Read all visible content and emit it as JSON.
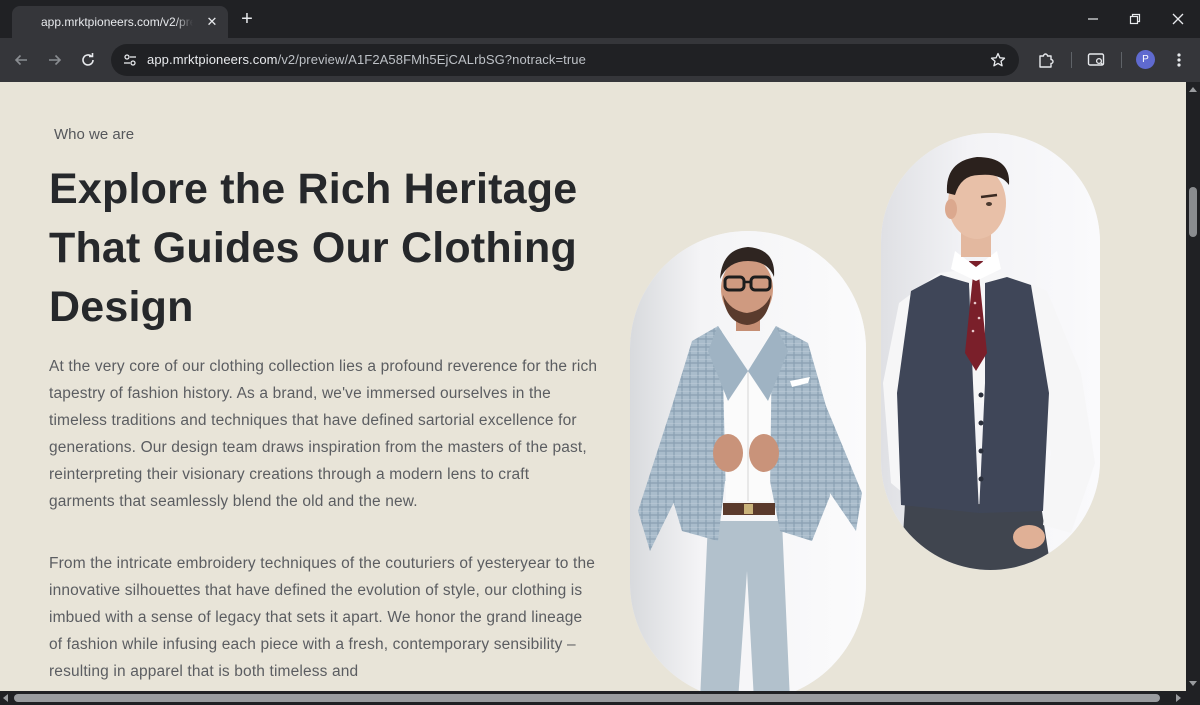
{
  "browser": {
    "tab_title": "app.mrktpioneers.com/v2/preview/A1F2A58FMh5EjCALrbSG",
    "url_host": "app.mrktpioneers.com",
    "url_path": "/v2/preview/A1F2A58FMh5EjCALrbSG?notrack=true",
    "profile_initial": "P",
    "close_tab_glyph": "✕",
    "new_tab_glyph": "+"
  },
  "page": {
    "eyebrow": "Who we are",
    "headline": "Explore the Rich Heritage That Guides Our Clothing Design",
    "paragraph_1": "At the very core of our clothing collection lies a profound reverence for the rich tapestry of fashion history. As a brand, we've immersed ourselves in the timeless traditions and techniques that have defined sartorial excellence for generations. Our design team draws inspiration from the masters of the past, reinterpreting their visionary creations through a modern lens to craft garments that seamlessly blend the old and the new.",
    "paragraph_2": "From the intricate embroidery techniques of the couturiers of yesteryear to the innovative silhouettes that have defined the evolution of style, our clothing is imbued with a sense of legacy that sets it apart. We honor the grand lineage of fashion while infusing each piece with a fresh, contemporary sensibility – resulting in apparel that is both timeless and"
  },
  "colors": {
    "page_background": "#e8e4d8",
    "heading": "#26282b",
    "body_text": "#5b5d61",
    "chrome_dark": "#202124",
    "chrome_toolbar": "#35363a"
  },
  "icons": {
    "back": "arrow-left-icon",
    "forward": "arrow-right-icon",
    "reload": "reload-icon",
    "site_info": "tune-icon",
    "bookmark": "star-icon",
    "extensions": "puzzle-icon",
    "cast": "cast-search-icon",
    "menu": "kebab-menu-icon"
  }
}
